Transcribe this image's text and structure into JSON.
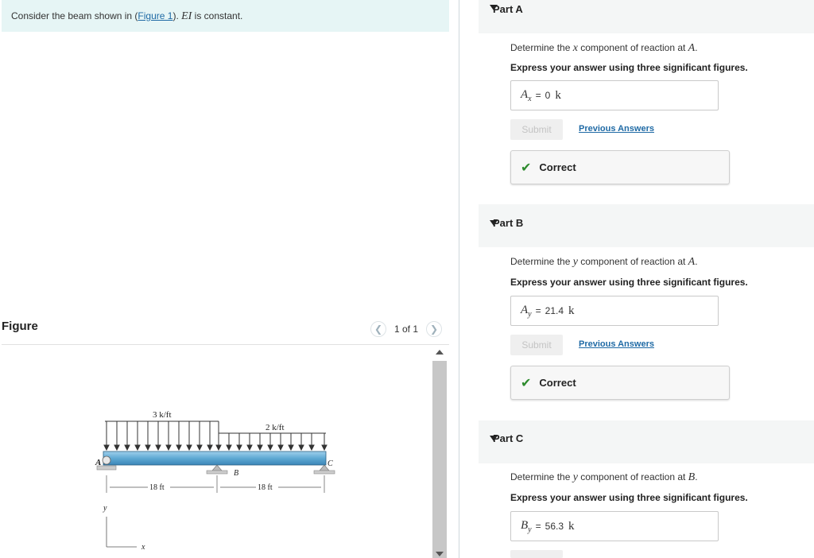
{
  "intro": {
    "text_before": "Consider the beam shown in (",
    "figure_link": "Figure 1",
    "text_after": "). ",
    "math": "EI",
    "text_end": " is constant."
  },
  "figure": {
    "title": "Figure",
    "page_count": "1 of 1",
    "prev_icon": "chevron-left-icon",
    "next_icon": "chevron-right-icon",
    "labels": {
      "load_left": "3 k/ft",
      "load_right": "2 k/ft",
      "point_a": "A",
      "point_b": "B",
      "point_c": "C",
      "span_left": "18 ft",
      "span_right": "18 ft",
      "axis_y": "y",
      "axis_x": "x"
    }
  },
  "parts": [
    {
      "title": "Part A",
      "question_pre": "Determine the ",
      "question_var": "x",
      "question_mid": " component of reaction at ",
      "question_point": "A",
      "question_end": ".",
      "instruction": "Express your answer using three significant figures.",
      "answer_symbol": "A",
      "answer_sub": "x",
      "answer_eq": "=",
      "answer_value": "0",
      "answer_unit": "k",
      "submit_label": "Submit",
      "previous_label": "Previous Answers",
      "feedback": "Correct"
    },
    {
      "title": "Part B",
      "question_pre": "Determine the ",
      "question_var": "y",
      "question_mid": " component of reaction at ",
      "question_point": "A",
      "question_end": ".",
      "instruction": "Express your answer using three significant figures.",
      "answer_symbol": "A",
      "answer_sub": "y",
      "answer_eq": "=",
      "answer_value": "21.4",
      "answer_unit": "k",
      "submit_label": "Submit",
      "previous_label": "Previous Answers",
      "feedback": "Correct"
    },
    {
      "title": "Part C",
      "question_pre": "Determine the ",
      "question_var": "y",
      "question_mid": " component of reaction at ",
      "question_point": "B",
      "question_end": ".",
      "instruction": "Express your answer using three significant figures.",
      "answer_symbol": "B",
      "answer_sub": "y",
      "answer_eq": "=",
      "answer_value": "56.3",
      "answer_unit": "k"
    }
  ],
  "colors": {
    "intro_bg": "#e6f5f5",
    "link": "#1f6aa5",
    "check": "#2e8b2e",
    "beam": "#5fa9d3"
  }
}
